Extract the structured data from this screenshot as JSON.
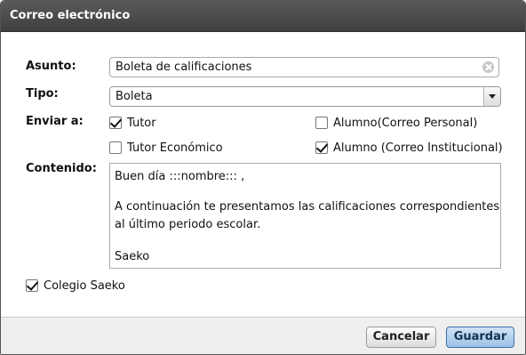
{
  "window": {
    "title": "Correo electrónico"
  },
  "form": {
    "subject_label": "Asunto:",
    "subject_value": "Boleta de calificaciones",
    "type_label": "Tipo:",
    "type_value": "Boleta",
    "send_to_label": "Enviar a:",
    "recipients": {
      "tutor": {
        "label": "Tutor",
        "checked": true
      },
      "alumno_personal": {
        "label": "Alumno(Correo Personal)",
        "checked": false
      },
      "tutor_economico": {
        "label": "Tutor Económico",
        "checked": false
      },
      "alumno_institucional": {
        "label": "Alumno (Correo Institucional)",
        "checked": true
      }
    },
    "content_label": "Contenido:",
    "content_lines": [
      "Buen día :::nombre::: ,",
      "",
      "A continuación te presentamos las calificaciones correspondientes",
      "al último periodo escolar.",
      "",
      "Saeko"
    ],
    "school_checkbox": {
      "label": "Colegio Saeko",
      "checked": true
    }
  },
  "footer": {
    "cancel_label": "Cancelar",
    "save_label": "Guardar"
  },
  "icons": {
    "clear": "clear-circle-x-icon",
    "dropdown": "chevron-down-icon",
    "check": "checkmark-icon"
  }
}
